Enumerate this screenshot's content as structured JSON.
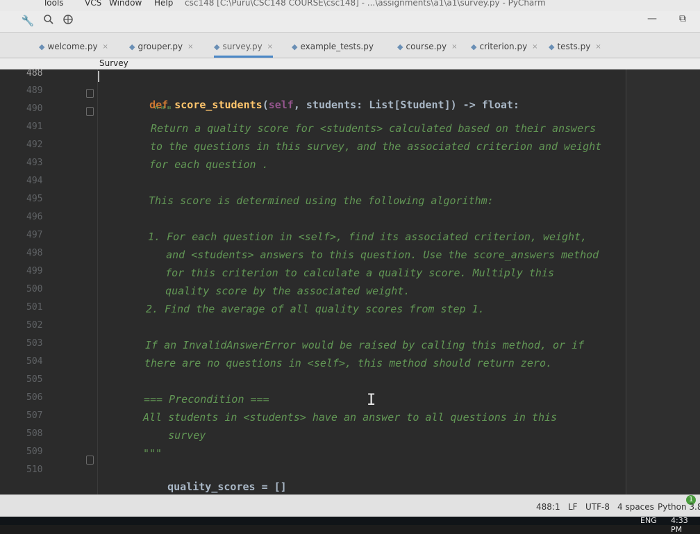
{
  "menubar": {
    "items": [
      "Tools",
      "VCS",
      "Window",
      "Help"
    ],
    "title": "csc148 [C:\\Puru\\CSC148 COURSE\\csc148] - ...\\assignments\\a1\\a1\\survey.py - PyCharm"
  },
  "toolbar": {
    "icons": [
      "wrench-icon",
      "search-icon",
      "globe-icon"
    ],
    "minimize": "—",
    "restore": "⧉"
  },
  "tabs": [
    {
      "label": "welcome.py",
      "close": "×"
    },
    {
      "label": "grouper.py",
      "close": "×"
    },
    {
      "label": "survey.py",
      "close": "×"
    },
    {
      "label": "example_tests.py",
      "close": ""
    },
    {
      "label": "course.py",
      "close": "×"
    },
    {
      "label": "criterion.py",
      "close": "×"
    },
    {
      "label": "tests.py",
      "close": "×"
    }
  ],
  "breadcrumb": "Survey",
  "line_numbers": [
    "488",
    "489",
    "490",
    "491",
    "492",
    "493",
    "494",
    "495",
    "496",
    "497",
    "498",
    "499",
    "500",
    "501",
    "502",
    "503",
    "504",
    "505",
    "506",
    "507",
    "508",
    "509",
    "510"
  ],
  "code": {
    "l489_def": "def ",
    "l489_name": "score_students",
    "l489_open": "(",
    "l489_self": "self",
    "l489_rest": ", students: List[Student]) -> float:",
    "l490": "\"\"\"",
    "l491": "Return a quality score for <students> calculated based on their answers",
    "l492": "to the questions in this survey, and the associated criterion and weight",
    "l493": "for each question .",
    "l495": "This score is determined using the following algorithm:",
    "l497": "1. For each question in <self>, find its associated criterion, weight,",
    "l498": "   and <students> answers to this question. Use the score_answers method",
    "l499": "   for this criterion to calculate a quality score. Multiply this",
    "l500": "   quality score by the associated weight.",
    "l501": "2. Find the average of all quality scores from step 1.",
    "l503": "If an InvalidAnswerError would be raised by calling this method, or if",
    "l504": "there are no questions in <self>, this method should return zero.",
    "l506": "=== Precondition ===",
    "l507": "All students in <students> have an answer to all questions in this",
    "l508": "    survey",
    "l509": "\"\"\"",
    "l510": "quality_scores = []"
  },
  "cursor_glyph": "I",
  "statusbar": {
    "position": "488:1",
    "line_sep": "LF",
    "encoding": "UTF-8",
    "indent": "4 spaces",
    "interpreter": "Python 3.8",
    "notification": "1"
  },
  "taskbar": {
    "lang": "ENG",
    "time": "4:33 PM"
  }
}
